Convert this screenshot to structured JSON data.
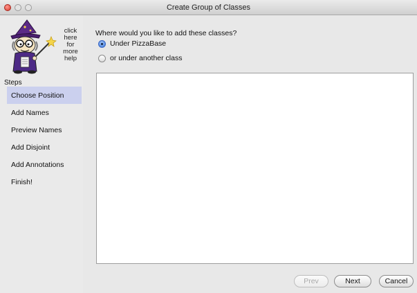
{
  "window": {
    "title": "Create Group of Classes"
  },
  "sidebar": {
    "help_lines": [
      "click",
      "here",
      "for",
      "more",
      "help"
    ],
    "steps_label": "Steps",
    "steps": [
      {
        "label": "Choose Position",
        "active": true
      },
      {
        "label": "Add Names",
        "active": false
      },
      {
        "label": "Preview Names",
        "active": false
      },
      {
        "label": "Add Disjoint",
        "active": false
      },
      {
        "label": "Add Annotations",
        "active": false
      },
      {
        "label": "Finish!",
        "active": false
      }
    ]
  },
  "main": {
    "question": "Where would you like to add these classes?",
    "options": [
      {
        "label": "Under PizzaBase",
        "checked": true
      },
      {
        "label": "or under another class",
        "checked": false
      }
    ]
  },
  "buttons": {
    "prev": "Prev",
    "next": "Next",
    "cancel": "Cancel"
  },
  "colors": {
    "active_step": "#cbd0ee",
    "close_button": "#d9382c"
  }
}
